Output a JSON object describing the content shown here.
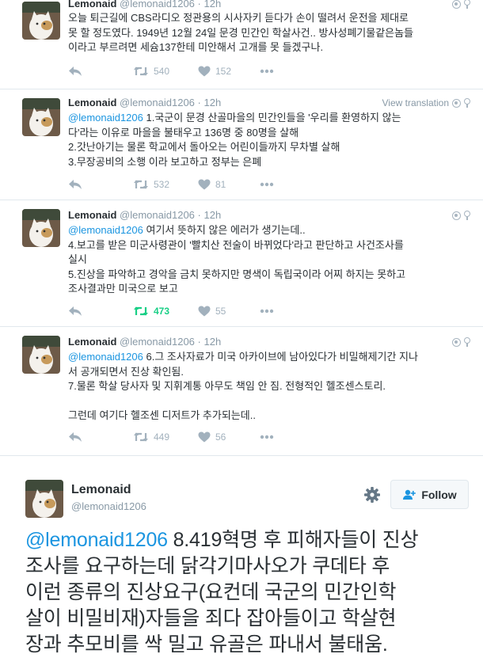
{
  "colors": {
    "link": "#1b95e0",
    "text": "#292f33",
    "meta": "#8899a6",
    "retweet_active": "#19cf86",
    "divider": "#e1e8ed"
  },
  "icons": {
    "reply": "reply-icon",
    "retweet": "retweet-icon",
    "like": "heart-icon",
    "more": "more-dots-icon",
    "globe": "globe-icon",
    "pin": "location-pin-icon",
    "gear": "gear-icon",
    "follow": "add-user-icon"
  },
  "feed": [
    {
      "name": "Lemonaid",
      "handle": "@lemonaid1206",
      "separator": "·",
      "time": "12h",
      "translation": "",
      "mention": "",
      "lines": [
        "오늘 퇴근길에 CBS라디오 정관용의 시사자키 듣다가 손이 떨려서 운전을 제대로",
        "못 할 정도였다. 1949년 12월 24일 문경 민간인 학살사건.. 방사성폐기물같은놈들",
        "이라고 부르려면 세슘137한테 미안해서 고개를 못 들겠구나."
      ],
      "retweets": "540",
      "likes": "152",
      "retweeted": false
    },
    {
      "name": "Lemonaid",
      "handle": "@lemonaid1206",
      "separator": "·",
      "time": "12h",
      "translation": "View translation",
      "mention": "@lemonaid1206",
      "lines": [
        " 1.국군이 문경 산골마을의 민간인들을 '우리를 환영하지 않는",
        "다'라는 이유로 마을을 불태우고 136명 중 80명을 살해",
        "2.갓난아기는 물론 학교에서 돌아오는 어린이들까지 무차별 살해",
        "3.무장공비의 소행 이라 보고하고 정부는 은폐"
      ],
      "retweets": "532",
      "likes": "81",
      "retweeted": false
    },
    {
      "name": "Lemonaid",
      "handle": "@lemonaid1206",
      "separator": "·",
      "time": "12h",
      "translation": "",
      "mention": "@lemonaid1206",
      "lines": [
        " 여기서 뜻하지 않은 에러가 생기는데..",
        "4.보고를 받은 미군사령관이 '빨치산 전술이 바뀌었다'라고 판단하고 사건조사를",
        "실시",
        "5.진상을 파악하고 경악을 금치 못하지만 명색이 독립국이라 어찌 하지는 못하고",
        "조사결과만 미국으로 보고"
      ],
      "retweets": "473",
      "likes": "55",
      "retweeted": true
    },
    {
      "name": "Lemonaid",
      "handle": "@lemonaid1206",
      "separator": "·",
      "time": "12h",
      "translation": "",
      "mention": "@lemonaid1206",
      "lines": [
        " 6.그 조사자료가 미국 아카이브에 남아있다가 비밀해제기간 지나",
        "서 공개되면서 진상 확인됨.",
        "7.물론 학살 당사자 및 지휘계통 아무도 책임 안 짐. 전형적인 헬조센스토리.",
        "",
        "그런데 여기다 헬조센 디저트가 추가되는데.."
      ],
      "retweets": "449",
      "likes": "56",
      "retweeted": false
    }
  ],
  "detail": {
    "name": "Lemonaid",
    "handle": "@lemonaid1206",
    "follow_label": "Follow",
    "mention": "@lemonaid1206",
    "lines": [
      " 8.419혁명 후 피해자들이 진상",
      "조사를 요구하는데 닭각기마사오가 쿠데타 후",
      "이런 종류의 진상요구(요컨데 국군의 민간인학",
      "살이 비밀비재)자들을 죄다 잡아들이고 학살현",
      "장과 추모비를 싹 밀고 유골은 파내서 불태움."
    ]
  }
}
